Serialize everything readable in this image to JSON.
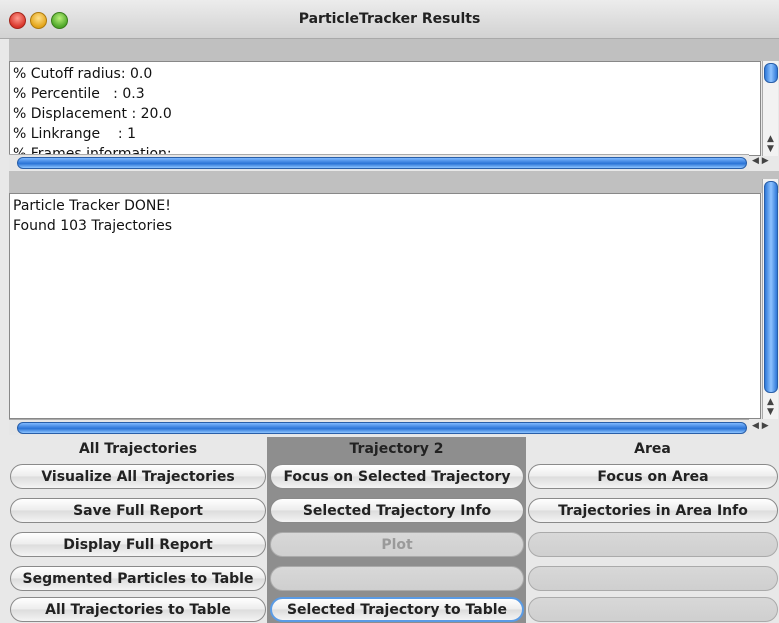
{
  "window": {
    "title": "ParticleTracker Results"
  },
  "params_area": {
    "lines": [
      "% Cutoff radius: 0.0",
      "% Percentile   : 0.3",
      "% Displacement : 20.0",
      "% Linkrange    : 1",
      "% Frames information:"
    ]
  },
  "results_area": {
    "lines": [
      "Particle Tracker DONE!",
      "Found 103 Trajectories"
    ]
  },
  "columns": {
    "all": {
      "header": "All Trajectories",
      "buttons": [
        "Visualize All Trajectories",
        "Save Full Report",
        "Display Full Report",
        "Segmented Particles to Table",
        "All Trajectories to Table"
      ]
    },
    "trajectory": {
      "header": "Trajectory 2",
      "buttons": [
        "Focus on Selected Trajectory",
        "Selected Trajectory Info",
        "Plot",
        "",
        "Selected Trajectory to Table"
      ]
    },
    "area": {
      "header": "Area",
      "buttons": [
        "Focus on Area",
        "Trajectories in Area Info",
        "",
        "",
        ""
      ]
    }
  }
}
